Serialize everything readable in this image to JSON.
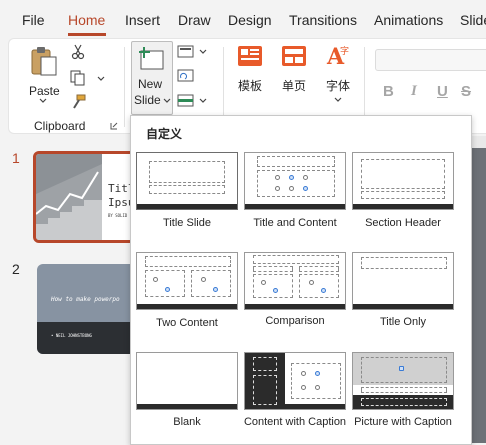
{
  "tabs": [
    "File",
    "Home",
    "Insert",
    "Draw",
    "Design",
    "Transitions",
    "Animations",
    "Slide"
  ],
  "active_tab": "Home",
  "ribbon": {
    "paste_label": "Paste",
    "clipboard_group": "Clipboard",
    "new_slide_line1": "New",
    "new_slide_line2": "Slide",
    "template_label": "模板",
    "single_page_label": "单页",
    "font_label": "字体",
    "bold": "B",
    "italic": "I",
    "underline": "U",
    "strike": "S"
  },
  "thumbnails": {
    "numbers": [
      "1",
      "2"
    ],
    "slide1_title_line1": "Titl",
    "slide1_title_line2": "Ipsu",
    "slide1_small": "BY SOLID",
    "slide2_title": "How to make powerpo",
    "slide2_author": "• NEIL JOHNSTBONG"
  },
  "gallery": {
    "title": "自定义",
    "layouts": [
      "Title Slide",
      "Title and Content",
      "Section Header",
      "Two Content",
      "Comparison",
      "Title Only",
      "Blank",
      "Content with Caption",
      "Picture with Caption"
    ]
  },
  "colors": {
    "accent": "#b7472a",
    "bar": "#2b2b2b"
  }
}
